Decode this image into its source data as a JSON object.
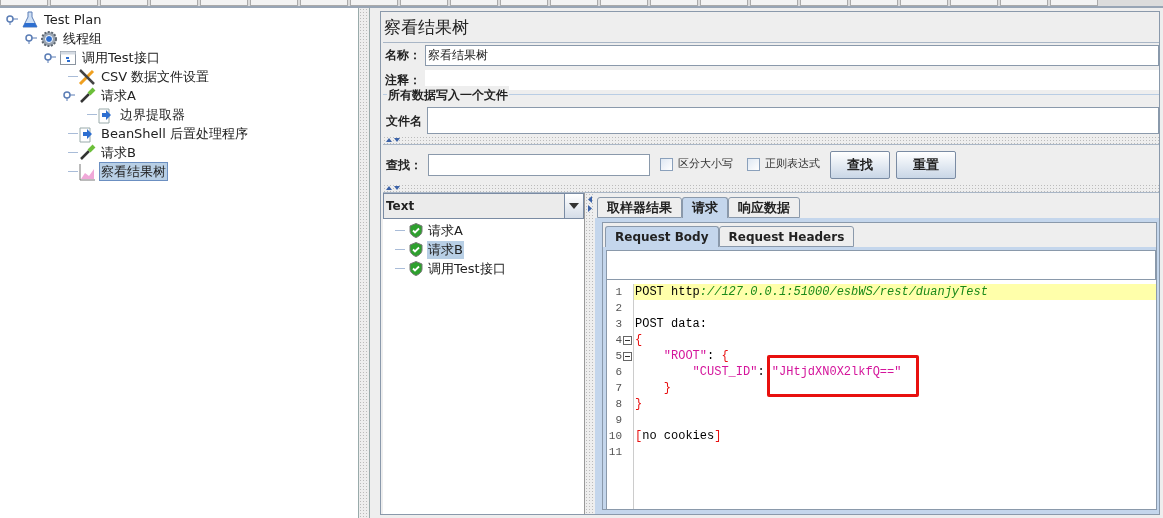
{
  "tree": [
    {
      "label": "Test Plan",
      "kind": "flask",
      "selected": false,
      "expanded": true,
      "children": [
        {
          "label": "线程组",
          "kind": "gear",
          "selected": false,
          "expanded": true,
          "children": [
            {
              "label": "调用Test接口",
              "kind": "controller",
              "selected": false,
              "expanded": true,
              "children": [
                {
                  "label": "CSV 数据文件设置",
                  "kind": "config",
                  "selected": false
                },
                {
                  "label": "请求A",
                  "kind": "sampler",
                  "selected": false,
                  "expanded": true,
                  "children": [
                    {
                      "label": "边界提取器",
                      "kind": "postprocessor",
                      "selected": false
                    }
                  ]
                },
                {
                  "label": "BeanShell 后置处理程序",
                  "kind": "postprocessor",
                  "selected": false
                },
                {
                  "label": "请求B",
                  "kind": "sampler",
                  "selected": false
                },
                {
                  "label": "察看结果树",
                  "kind": "listener",
                  "selected": true
                }
              ]
            }
          ]
        }
      ]
    }
  ],
  "panel": {
    "title": "察看结果树",
    "name_label": "名称：",
    "name_value": "察看结果树",
    "comment_label": "注释：",
    "file_group": "所有数据写入一个文件",
    "file_label": "文件名"
  },
  "search": {
    "label": "查找：",
    "options": [
      {
        "label": "区分大小写",
        "checked": false
      },
      {
        "label": "正则表达式",
        "checked": false
      }
    ],
    "buttons": [
      "查找",
      "重置"
    ]
  },
  "renderer": {
    "value": "Text"
  },
  "results": [
    {
      "label": "请求A",
      "selected": false
    },
    {
      "label": "请求B",
      "selected": true
    },
    {
      "label": "调用Test接口",
      "selected": false
    }
  ],
  "tabs": [
    {
      "label": "取样器结果",
      "selected": false
    },
    {
      "label": "请求",
      "selected": true
    },
    {
      "label": "响应数据",
      "selected": false
    }
  ],
  "subtabs": [
    {
      "label": "Request Body",
      "selected": true
    },
    {
      "label": "Request Headers",
      "selected": false
    }
  ],
  "code": [
    {
      "number": "1",
      "highlighted": true,
      "tokens": [
        {
          "text": "POST http",
          "kind": "plain"
        },
        {
          "text": "://127.0.0.1:51000/esbWS/rest/duanjyTest",
          "kind": "url"
        }
      ]
    },
    {
      "number": "2"
    },
    {
      "number": "3",
      "tokens": [
        {
          "text": "POST data:",
          "kind": "plain"
        }
      ]
    },
    {
      "number": "4",
      "fold": true,
      "tokens": [
        {
          "text": "{",
          "kind": "bracket"
        }
      ]
    },
    {
      "number": "5",
      "fold": true,
      "tokens": [
        {
          "text": "    \"ROOT\"",
          "kind": "string"
        },
        {
          "text": ": ",
          "kind": "plain"
        },
        {
          "text": "{",
          "kind": "bracket"
        }
      ]
    },
    {
      "number": "6",
      "tokens": [
        {
          "text": "        \"CUST_ID\"",
          "kind": "string"
        },
        {
          "text": ": ",
          "kind": "plain"
        },
        {
          "text": "\"JHtjdXN0X2lkfQ==\"",
          "kind": "string",
          "marked": true
        }
      ]
    },
    {
      "number": "7",
      "tokens": [
        {
          "text": "    }",
          "kind": "bracket"
        }
      ]
    },
    {
      "number": "8",
      "tokens": [
        {
          "text": "}",
          "kind": "bracket"
        }
      ]
    },
    {
      "number": "9"
    },
    {
      "number": "10",
      "tokens": [
        {
          "text": "[",
          "kind": "bracket"
        },
        {
          "text": "no cookies",
          "kind": "plain"
        },
        {
          "text": "]",
          "kind": "bracket"
        }
      ]
    },
    {
      "number": "11"
    }
  ]
}
